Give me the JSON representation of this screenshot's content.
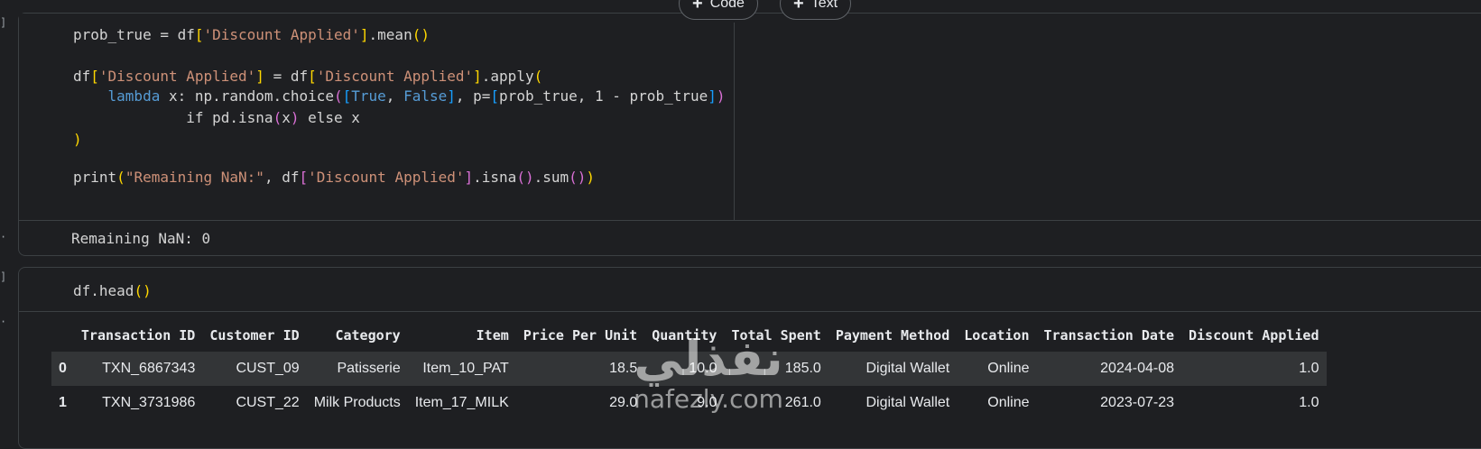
{
  "toolbar": {
    "add_code": "Code",
    "add_text": "Text"
  },
  "gutter": {
    "top_mark": "]",
    "mid_mark": "·",
    "cell2_mark": "]",
    "cell2_mark2": "·"
  },
  "cell1": {
    "lines": [
      "prob_true = df['Discount Applied'].mean()",
      "",
      "df['Discount Applied'] = df['Discount Applied'].apply(",
      "    lambda x: np.random.choice([True, False], p=[prob_true, 1 - prob_true])",
      "             if pd.isna(x) else x",
      ")",
      "",
      "print(\"Remaining NaN:\", df['Discount Applied'].isna().sum())"
    ],
    "output": "Remaining NaN: 0"
  },
  "cell2": {
    "code": "df.head()",
    "table": {
      "columns": [
        "",
        "Transaction ID",
        "Customer ID",
        "Category",
        "Item",
        "Price Per Unit",
        "Quantity",
        "Total Spent",
        "Payment Method",
        "Location",
        "Transaction Date",
        "Discount Applied"
      ],
      "rows": [
        [
          "0",
          "TXN_6867343",
          "CUST_09",
          "Patisserie",
          "Item_10_PAT",
          "18.5",
          "10.0",
          "185.0",
          "Digital Wallet",
          "Online",
          "2024-04-08",
          "1.0"
        ],
        [
          "1",
          "TXN_3731986",
          "CUST_22",
          "Milk Products",
          "Item_17_MILK",
          "29.0",
          "9.0",
          "261.0",
          "Digital Wallet",
          "Online",
          "2023-07-23",
          "1.0"
        ]
      ]
    }
  },
  "watermark": {
    "arabic": "نفذلي",
    "latin": "nafezly.com"
  }
}
